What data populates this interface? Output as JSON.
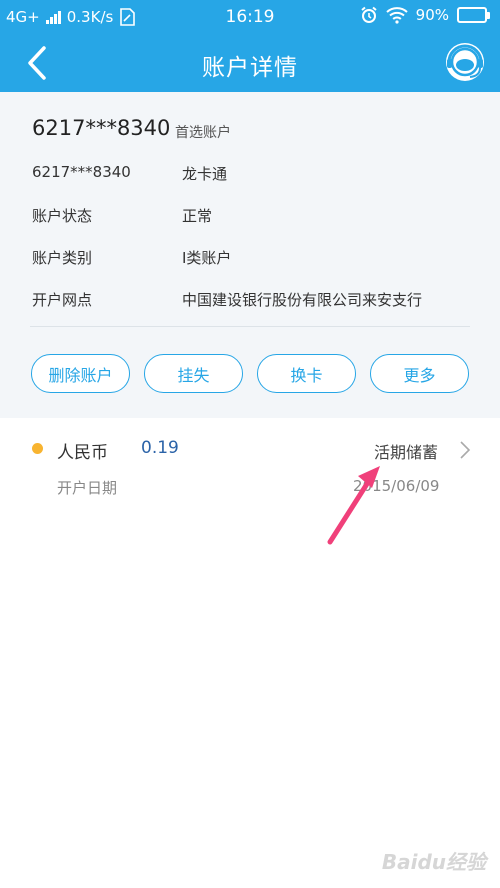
{
  "status_bar": {
    "network": "4G+",
    "speed": "0.3K/s",
    "time": "16:19",
    "battery": "90%",
    "battery_level": 0.9
  },
  "header": {
    "title": "账户详情",
    "back_icon": "chevron-left-icon",
    "service_icon": "customer-service-icon"
  },
  "account": {
    "number": "6217***8340",
    "badge": "首选账户",
    "details": [
      {
        "label": "6217***8340",
        "value": "龙卡通"
      },
      {
        "label": "账户状态",
        "value": "正常"
      },
      {
        "label": "账户类别",
        "value": "I类账户"
      },
      {
        "label": "开户网点",
        "value": "中国建设银行股份有限公司来安支行"
      }
    ]
  },
  "actions": {
    "delete": "删除账户",
    "report_loss": "挂失",
    "replace_card": "换卡",
    "more": "更多"
  },
  "sub_account": {
    "currency": "人民币",
    "balance": "0.19",
    "type": "活期储蓄",
    "open_date_label": "开户日期",
    "open_date": "2015/06/09"
  },
  "watermark": "Baidu经验",
  "colors": {
    "header_bg": "#27a6e6",
    "info_bg": "#f3f6f9",
    "accent": "#27a6e6",
    "amount": "#2b63a8",
    "dot": "#f8b430",
    "annotation_arrow": "#f0407a"
  }
}
